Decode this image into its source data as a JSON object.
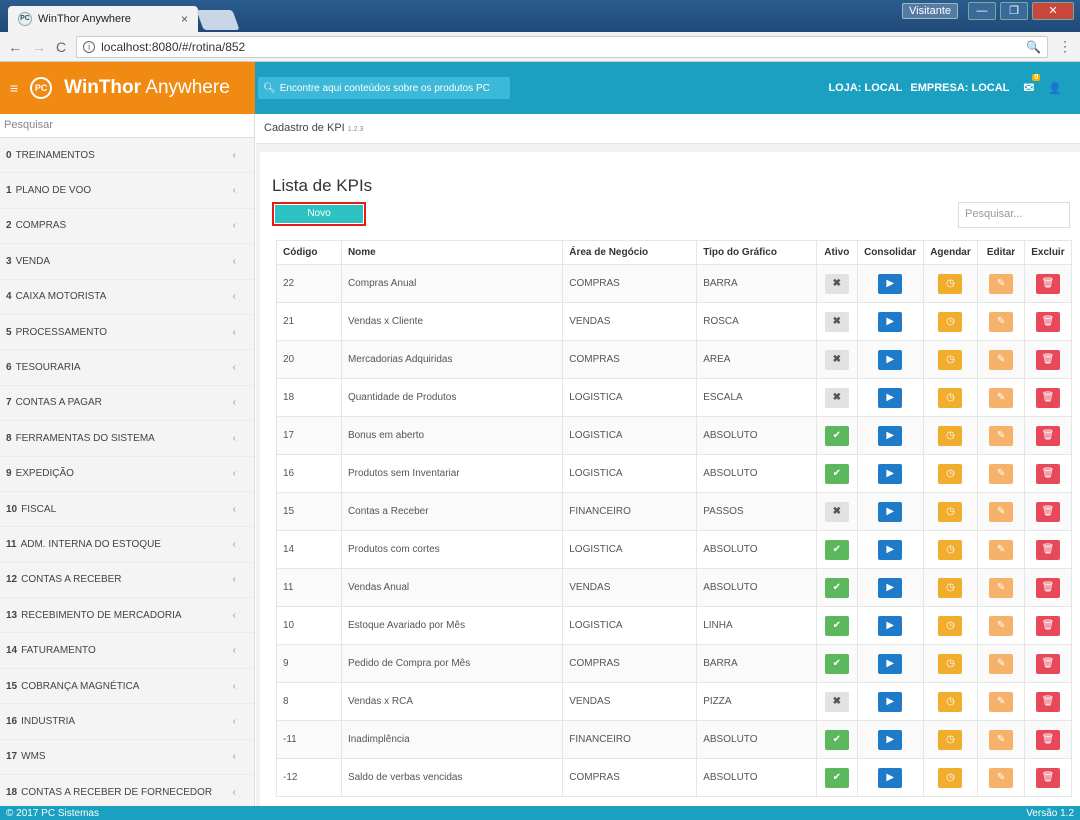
{
  "browser": {
    "tab_title": "WinThor Anywhere",
    "tab_close": "×",
    "url": "localhost:8080/#/rotina/852",
    "visitante": "Visitante",
    "win_min": "—",
    "win_max": "❐",
    "win_close": "✕"
  },
  "header": {
    "menu_icon": "≡",
    "logo_text": "PC",
    "brand_bold": "WinThor",
    "brand_light": "Anywhere",
    "search_placeholder": "Encontre aqui conteúdos sobre os produtos PC",
    "loja": "LOJA: LOCAL",
    "empresa": "EMPRESA: LOCAL",
    "mail_badge": "0"
  },
  "sidebar": {
    "search_placeholder": "Pesquisar",
    "items": [
      {
        "num": "0",
        "label": "TREINAMENTOS"
      },
      {
        "num": "1",
        "label": "PLANO DE VOO"
      },
      {
        "num": "2",
        "label": "COMPRAS"
      },
      {
        "num": "3",
        "label": "VENDA"
      },
      {
        "num": "4",
        "label": "CAIXA MOTORISTA"
      },
      {
        "num": "5",
        "label": "PROCESSAMENTO"
      },
      {
        "num": "6",
        "label": "TESOURARIA"
      },
      {
        "num": "7",
        "label": "CONTAS A PAGAR"
      },
      {
        "num": "8",
        "label": "FERRAMENTAS DO SISTEMA"
      },
      {
        "num": "9",
        "label": "EXPEDIÇÃO"
      },
      {
        "num": "10",
        "label": "FISCAL"
      },
      {
        "num": "11",
        "label": "ADM. INTERNA DO ESTOQUE"
      },
      {
        "num": "12",
        "label": "CONTAS A RECEBER"
      },
      {
        "num": "13",
        "label": "RECEBIMENTO DE MERCADORIA"
      },
      {
        "num": "14",
        "label": "FATURAMENTO"
      },
      {
        "num": "15",
        "label": "COBRANÇA MAGNÉTICA"
      },
      {
        "num": "16",
        "label": "INDUSTRIA"
      },
      {
        "num": "17",
        "label": "WMS"
      },
      {
        "num": "18",
        "label": "CONTAS A RECEBER DE FORNECEDOR"
      }
    ]
  },
  "breadcrumb": {
    "label": "Cadastro de KPI",
    "version": "1.2.3"
  },
  "main": {
    "title": "Lista de KPIs",
    "new_button": "Novo",
    "search_placeholder": "Pesquisar..."
  },
  "table": {
    "headers": [
      "Código",
      "Nome",
      "Área de Negócio",
      "Tipo do Gráfico",
      "Ativo",
      "Consolidar",
      "Agendar",
      "Editar",
      "Excluir"
    ],
    "rows": [
      {
        "codigo": "22",
        "nome": "Compras Anual",
        "area": "COMPRAS",
        "tipo": "BARRA",
        "ativo": false
      },
      {
        "codigo": "21",
        "nome": "Vendas x Cliente",
        "area": "VENDAS",
        "tipo": "ROSCA",
        "ativo": false
      },
      {
        "codigo": "20",
        "nome": "Mercadorias Adquiridas",
        "area": "COMPRAS",
        "tipo": "AREA",
        "ativo": false
      },
      {
        "codigo": "18",
        "nome": "Quantidade de Produtos",
        "area": "LOGISTICA",
        "tipo": "ESCALA",
        "ativo": false
      },
      {
        "codigo": "17",
        "nome": "Bonus em aberto",
        "area": "LOGISTICA",
        "tipo": "ABSOLUTO",
        "ativo": true
      },
      {
        "codigo": "16",
        "nome": "Produtos sem Inventariar",
        "area": "LOGISTICA",
        "tipo": "ABSOLUTO",
        "ativo": true
      },
      {
        "codigo": "15",
        "nome": "Contas a Receber",
        "area": "FINANCEIRO",
        "tipo": "PASSOS",
        "ativo": false
      },
      {
        "codigo": "14",
        "nome": "Produtos com cortes",
        "area": "LOGISTICA",
        "tipo": "ABSOLUTO",
        "ativo": true
      },
      {
        "codigo": "11",
        "nome": "Vendas Anual",
        "area": "VENDAS",
        "tipo": "ABSOLUTO",
        "ativo": true
      },
      {
        "codigo": "10",
        "nome": "Estoque Avariado por Mês",
        "area": "LOGISTICA",
        "tipo": "LINHA",
        "ativo": true
      },
      {
        "codigo": "9",
        "nome": "Pedido de Compra por Mês",
        "area": "COMPRAS",
        "tipo": "BARRA",
        "ativo": true
      },
      {
        "codigo": "8",
        "nome": "Vendas x RCA",
        "area": "VENDAS",
        "tipo": "PIZZA",
        "ativo": false
      },
      {
        "codigo": "-11",
        "nome": "Inadimplência",
        "area": "FINANCEIRO",
        "tipo": "ABSOLUTO",
        "ativo": true
      },
      {
        "codigo": "-12",
        "nome": "Saldo de verbas vencidas",
        "area": "COMPRAS",
        "tipo": "ABSOLUTO",
        "ativo": true
      }
    ]
  },
  "icons": {
    "check": "✔",
    "cross": "✖",
    "play": "▶",
    "clock": "◷",
    "edit": "✎",
    "trash": "🗑"
  },
  "footer": {
    "copyright": "© 2017 PC Sistemas",
    "version": "Versão 1.2"
  }
}
